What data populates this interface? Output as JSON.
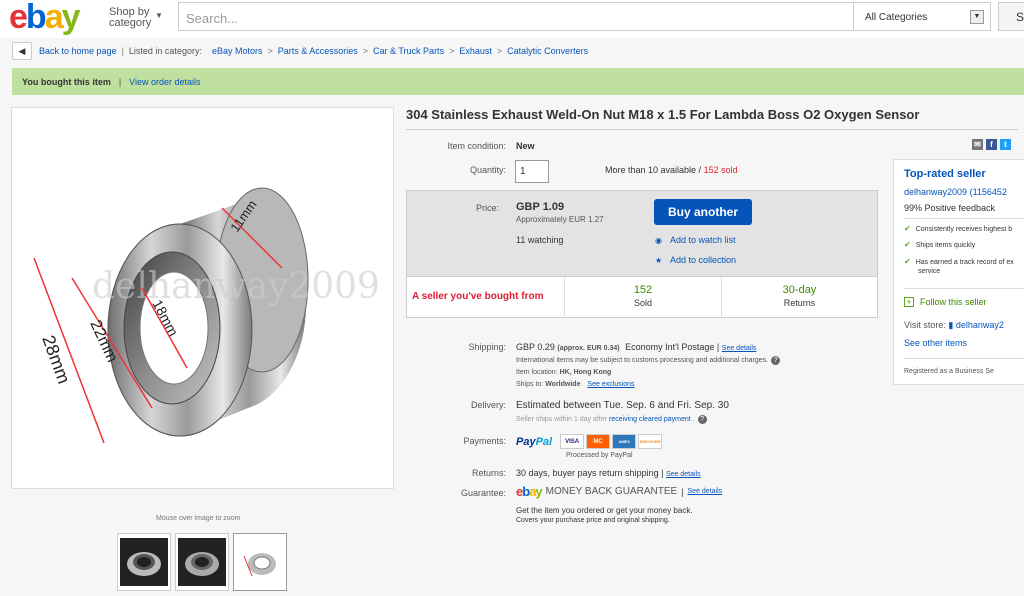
{
  "header": {
    "logo": {
      "e": "e",
      "b": "b",
      "a": "a",
      "y": "y"
    },
    "shop_by_line1": "Shop by",
    "shop_by_line2": "category",
    "search_placeholder": "Search...",
    "category_select": "All Categories",
    "search_button": "S"
  },
  "breadcrumb": {
    "back": "Back to home page",
    "listed_in": "Listed in category:",
    "items": [
      "eBay Motors",
      "Parts & Accessories",
      "Car & Truck Parts",
      "Exhaust",
      "Catalytic Converters"
    ]
  },
  "bought_bar": {
    "text": "You bought this item",
    "link": "View order details"
  },
  "gallery": {
    "zoom_hint": "Mouse over image to zoom",
    "watermark": "delhanway2009",
    "dims": [
      "11mm",
      "18mm",
      "22mm",
      "28mm"
    ]
  },
  "item": {
    "title": "304 Stainless Exhaust Weld-On Nut M18 x 1.5 For Lambda Boss O2 Oxygen Sensor",
    "condition_label": "Item condition:",
    "condition_value": "New",
    "quantity_label": "Quantity:",
    "quantity_value": "1",
    "availability": "More than 10 available /",
    "sold": "152 sold"
  },
  "buy_panel": {
    "price_label": "Price:",
    "price": "GBP 1.09",
    "approx": "Approximately EUR 1.27",
    "watching": "11 watching",
    "buy_button": "Buy another",
    "watch_link": "Add to watch list",
    "collection_link": "Add to collection",
    "bought_from": "A seller you've bought from",
    "stat1_num": "152",
    "stat1_label": "Sold",
    "stat2_num": "30-day",
    "stat2_label": "Returns"
  },
  "details": {
    "shipping_label": "Shipping:",
    "shipping_value": "GBP 0.29",
    "shipping_approx": "(approx. EUR 0.34)",
    "shipping_service": "Economy Int'l Postage |",
    "see_details": "See details",
    "intl_note": "International items may be subject to customs processing and additional charges.",
    "location_label": "Item location:",
    "location_value": "HK, Hong Kong",
    "ships_to_label": "Ships to:",
    "ships_to_value": "Worldwide",
    "see_exclusions": "See exclusions",
    "delivery_label": "Delivery:",
    "delivery_value": "Estimated between Tue. Sep. 6 and Fri. Sep. 30",
    "delivery_note_a": "Seller ships within 1 day after",
    "delivery_note_link": "receiving cleared payment",
    "payments_label": "Payments:",
    "paypal_a": "Pay",
    "paypal_b": "Pal",
    "cards": [
      "VISA",
      "MC",
      "AMEX",
      "DISCOVER"
    ],
    "processed": "Processed by PayPal",
    "returns_label": "Returns:",
    "returns_value": "30 days, buyer pays return shipping |",
    "guarantee_label": "Guarantee:",
    "mbg_ebay": {
      "e": "e",
      "b": "b",
      "a": "a",
      "y": "y"
    },
    "mbg_text": "MONEY BACK GUARANTEE",
    "mbg_note1": "Get the item you ordered or get your money back.",
    "mbg_note2": "Covers your purchase price and original shipping."
  },
  "seller": {
    "title": "Top-rated seller",
    "name": "delhanway2009",
    "score": "(1156452",
    "feedback": "99% Positive feedback",
    "bullets": [
      "Consistently receives highest b",
      "Ships items quickly",
      "Has earned a track record of ex",
      "service"
    ],
    "follow": "Follow this seller",
    "store_label": "Visit store:",
    "store_name": "delhanway2",
    "other": "See other items",
    "registered": "Registered as a Business Se"
  },
  "colors": {
    "ebay_red": "#e53238",
    "ebay_blue": "#0654ba",
    "ebay_yellow": "#f5af02",
    "ebay_green": "#86b817",
    "bought_bar": "#c0e0a0",
    "sold_red": "#dd1e31"
  }
}
